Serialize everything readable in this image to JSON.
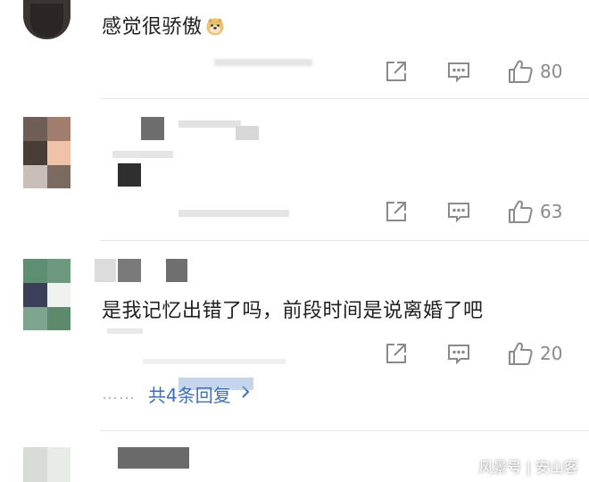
{
  "comments": [
    {
      "text": "感觉很骄傲",
      "emoji": "doge",
      "likes": "80",
      "icons": {
        "share": "share-icon",
        "reply": "comment-icon",
        "like": "thumbs-up-icon"
      }
    },
    {
      "text": "",
      "likes": "63",
      "icons": {
        "share": "share-icon",
        "reply": "comment-icon",
        "like": "thumbs-up-icon"
      }
    },
    {
      "text": "是我记忆出错了吗，前段时间是说离婚了吧",
      "likes": "20",
      "replies_label": "共4条回复",
      "replies_dots": "……",
      "icons": {
        "share": "share-icon",
        "reply": "comment-icon",
        "like": "thumbs-up-icon",
        "chevron": "chevron-right-icon"
      }
    }
  ],
  "watermark": "风景号 | 安山客",
  "colors": {
    "link": "#3d6fb5",
    "count": "#8a8a8a",
    "divider": "#e9e9e9"
  }
}
